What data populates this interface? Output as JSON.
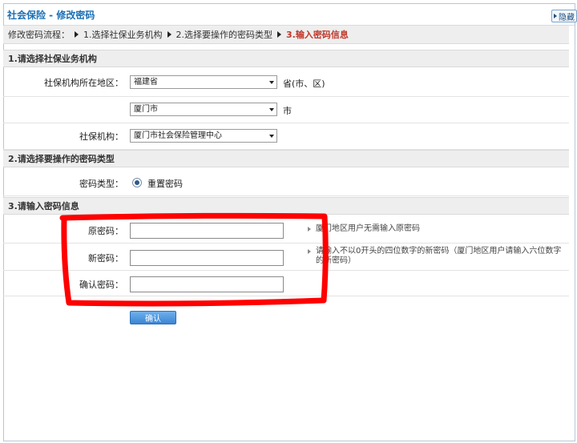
{
  "window": {
    "title": "社会保险 - 修改密码",
    "hide_label": "隐藏"
  },
  "flow": {
    "label": "修改密码流程：",
    "steps": [
      "1.选择社保业务机构",
      "2.选择要操作的密码类型",
      "3.输入密码信息"
    ],
    "current_step": 3
  },
  "section1": {
    "title": "1.请选择社保业务机构",
    "region_label": "社保机构所在地区：",
    "province_value": "福建省",
    "province_suffix": "省(市、区)",
    "city_value": "厦门市",
    "city_suffix": "市",
    "org_label": "社保机构：",
    "org_value": "厦门市社会保险管理中心"
  },
  "section2": {
    "title": "2.请选择要操作的密码类型",
    "type_label": "密码类型：",
    "option_label": "重置密码",
    "option_selected": true
  },
  "section3": {
    "title": "3.请输入密码信息",
    "old_label": "原密码：",
    "old_hint": "厦门地区用户无需输入原密码",
    "new_label": "新密码：",
    "new_hint": "请输入不以0开头的四位数字的新密码（厦门地区用户请输入六位数字的新密码）",
    "confirm_label": "确认密码："
  },
  "confirm_button": "确认",
  "annotation_color": "#ff0000",
  "colors": {
    "title": "#1a6fb5",
    "current_step": "#c0392b"
  }
}
